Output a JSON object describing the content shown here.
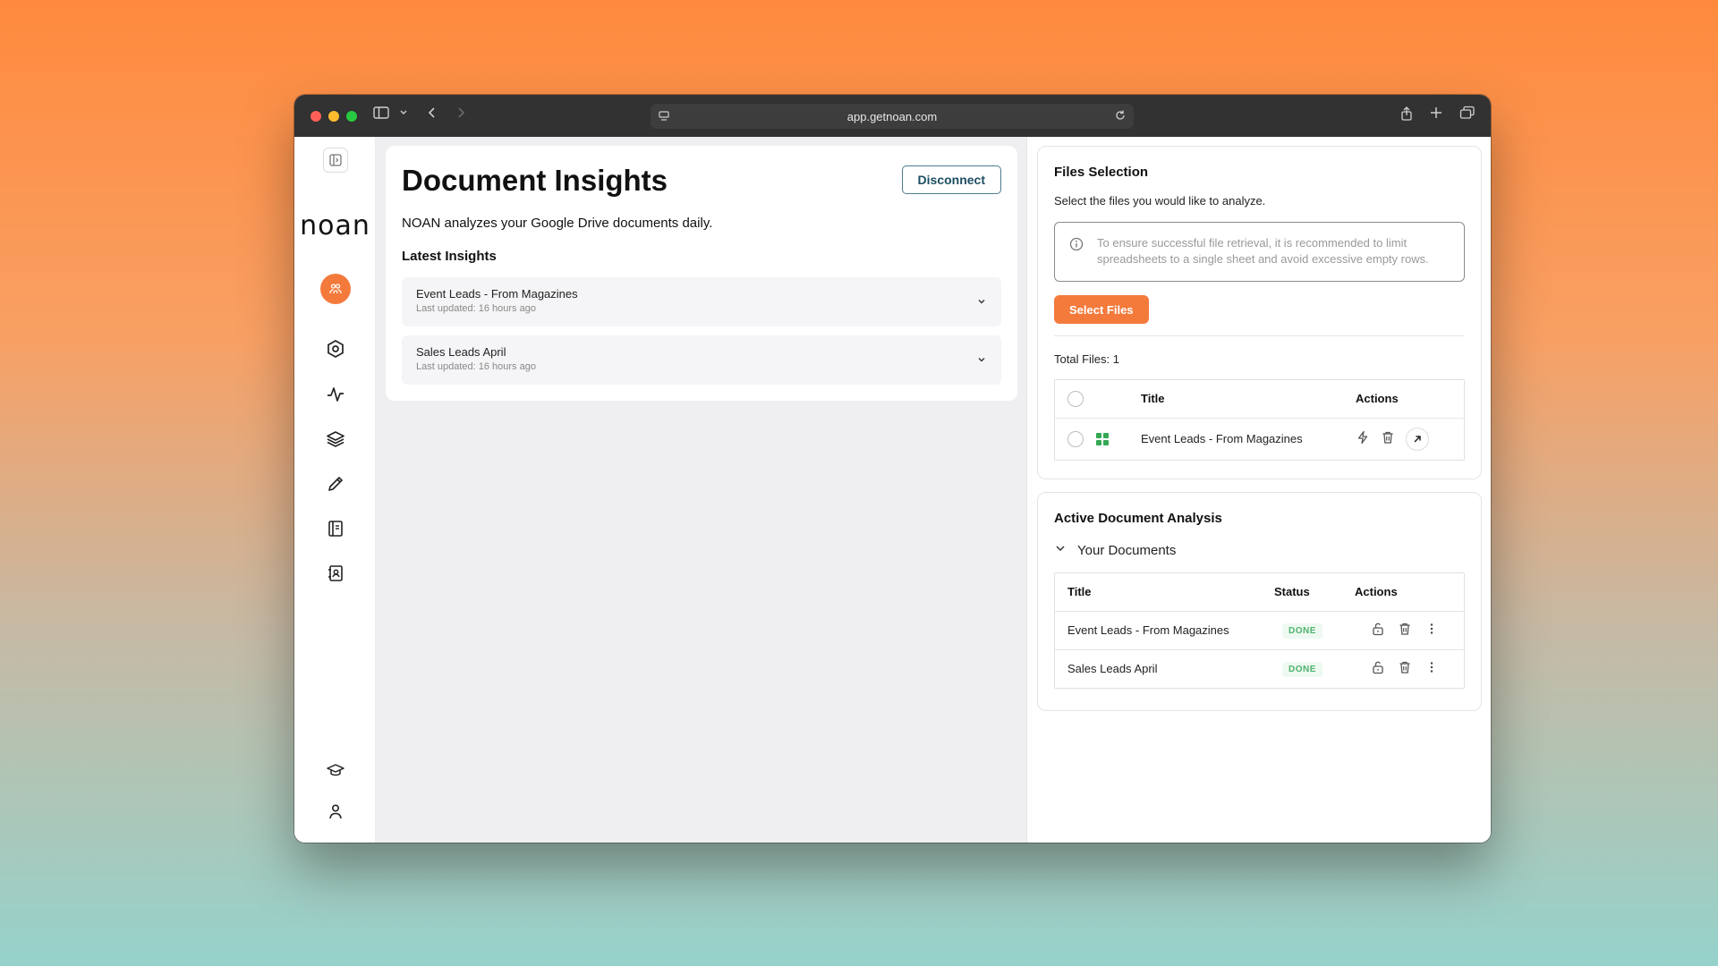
{
  "browser": {
    "url": "app.getnoan.com"
  },
  "sidebar": {
    "logo": "noan",
    "items": [
      {
        "icon": "hexagon-icon"
      },
      {
        "icon": "activity-icon"
      },
      {
        "icon": "layers-icon"
      },
      {
        "icon": "pencil-icon"
      },
      {
        "icon": "book-icon"
      },
      {
        "icon": "contacts-icon"
      },
      {
        "icon": "graduation-cap-icon"
      },
      {
        "icon": "user-icon"
      }
    ]
  },
  "main": {
    "title": "Document Insights",
    "disconnect_label": "Disconnect",
    "subtitle": "NOAN analyzes your Google Drive documents daily.",
    "latest_heading": "Latest Insights",
    "insights": [
      {
        "title": "Event Leads - From Magazines",
        "updated": "Last updated: 16 hours ago"
      },
      {
        "title": "Sales Leads April",
        "updated": "Last updated: 16 hours ago"
      }
    ]
  },
  "files_selection": {
    "heading": "Files Selection",
    "description": "Select the files you would like to analyze.",
    "info": "To ensure successful file retrieval, it is recommended to limit spreadsheets to a single sheet and avoid excessive empty rows.",
    "select_button": "Select Files",
    "total": "Total Files: 1",
    "columns": {
      "title": "Title",
      "actions": "Actions"
    },
    "rows": [
      {
        "title": "Event Leads - From Magazines"
      }
    ]
  },
  "analysis": {
    "heading": "Active Document Analysis",
    "group_label": "Your Documents",
    "columns": {
      "title": "Title",
      "status": "Status",
      "actions": "Actions"
    },
    "rows": [
      {
        "title": "Event Leads - From Magazines",
        "status": "DONE"
      },
      {
        "title": "Sales Leads April",
        "status": "DONE"
      }
    ]
  },
  "colors": {
    "accent": "#f47a3c",
    "done_text": "#4fb36c",
    "done_bg": "#eef9f1"
  }
}
